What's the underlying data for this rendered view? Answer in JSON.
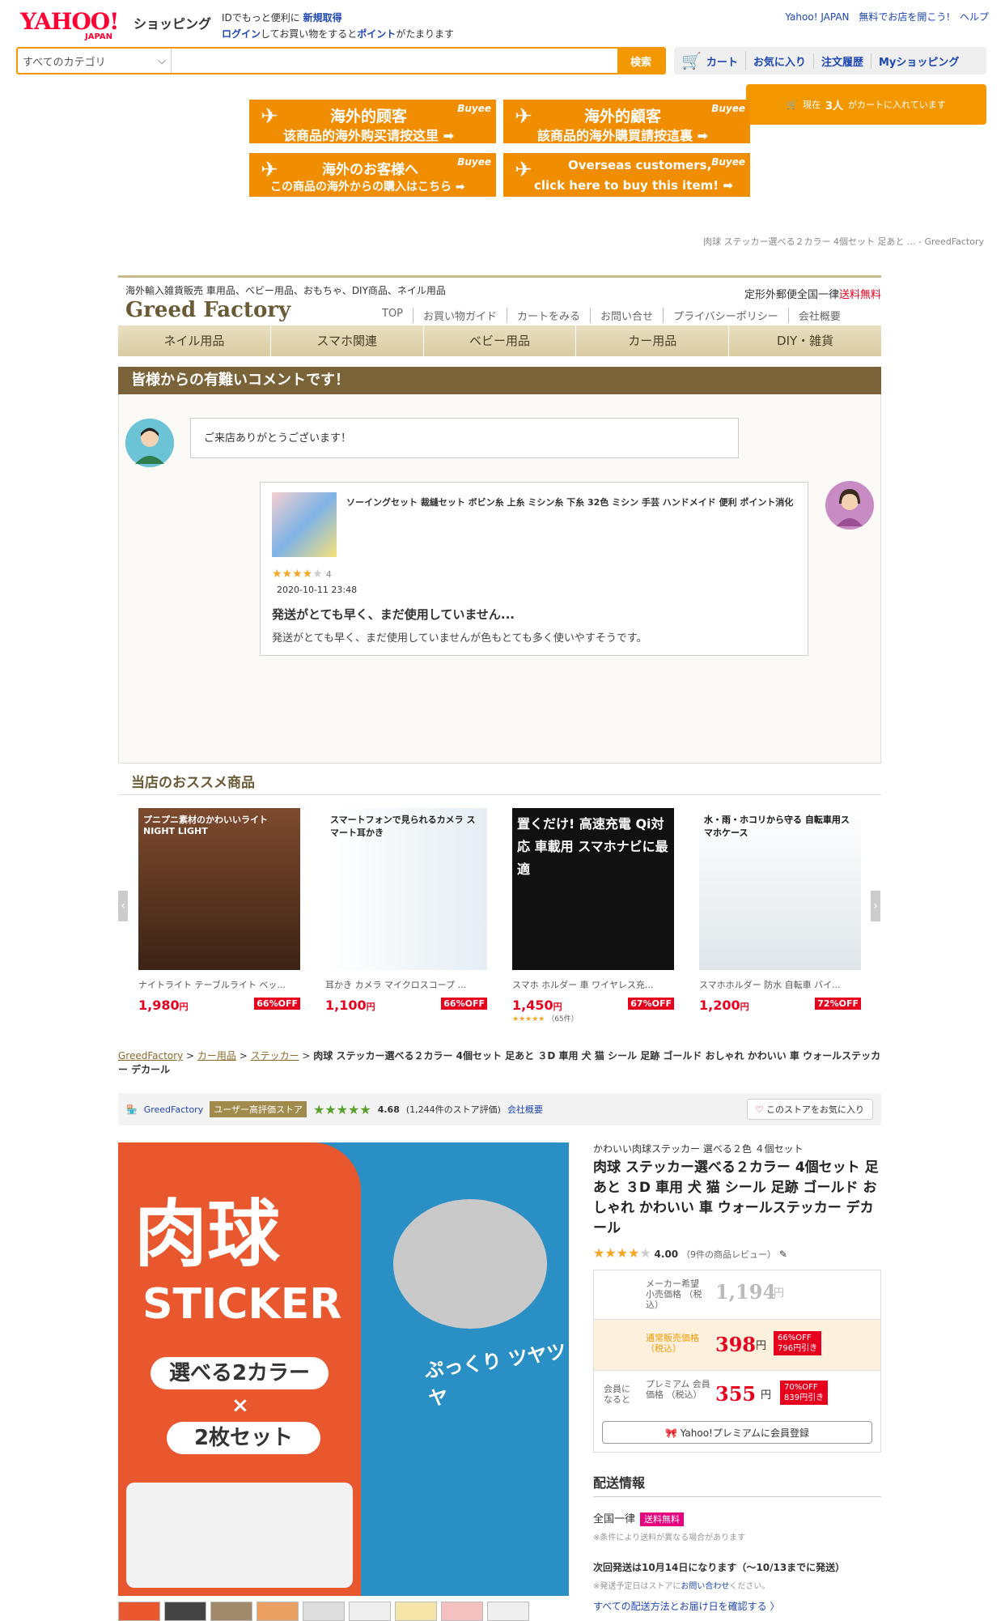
{
  "header": {
    "logo_main": "YAHOO!",
    "logo_sub": "JAPAN",
    "logo_shop": "ショッピング",
    "msg1_a": "IDでもっと便利に",
    "msg1_b": "新規取得",
    "msg2_a": "ログイン",
    "msg2_b": "してお買い物をすると",
    "msg2_c": "ポイント",
    "msg2_d": "がたまります",
    "links": [
      "Yahoo! JAPAN",
      "無料でお店を開こう!",
      "ヘルプ"
    ]
  },
  "search": {
    "category": "すべてのカテゴリ",
    "placeholder": "",
    "button": "検索"
  },
  "topnav": [
    "カート",
    "お気に入り",
    "注文履歴",
    "Myショッピング"
  ],
  "cart_popup": {
    "pre": "現在",
    "count": "3人",
    "post": "がカートに入れています"
  },
  "buyee": [
    {
      "t1": "海外的顾客",
      "t2": "该商品的海外购买请按这里 ➡"
    },
    {
      "t1": "海外的顧客",
      "t2": "該商品的海外購買請按這裏 ➡"
    },
    {
      "t1": "海外のお客様へ",
      "t2": "この商品の海外からの購入はこちら ➡"
    },
    {
      "t1": "Overseas customers,",
      "t2": "click here to buy this item! ➡"
    }
  ],
  "buyee_brand": "Buyee",
  "top_crumb": "肉球 ステッカー選べる２カラー 4個セット 足あと ... - GreedFactory",
  "store": {
    "tagline": "海外輸入雑貨販売 車用品、ベビー用品、おもちゃ、DIY商品、ネイル用品",
    "name": "Greed Factory",
    "ship_a": "定形外郵便全国一律",
    "ship_b": "送料無料",
    "menu": [
      "TOP",
      "お買い物ガイド",
      "カートをみる",
      "お問い合せ",
      "プライバシーポリシー",
      "会社概要"
    ],
    "cats": [
      "ネイル用品",
      "スマホ関連",
      "ベビー用品",
      "カー用品",
      "DIY・雑貨"
    ]
  },
  "comments": {
    "title": "皆様からの有難いコメントです！",
    "greeting": "ご来店ありがとうございます！",
    "review_product": "ソーイングセット 裁縫セット ボビン糸 上糸 ミシン糸 下糸 32色 ミシン 手芸 ハンドメイド 便利 ポイント消化",
    "review_rating": "4",
    "review_date": "2020-10-11 23:48",
    "review_title": "発送がとても早く、まだ使用していません...",
    "review_body": "発送がとても早く、まだ使用していませんが色もとても多く使いやすそうです。"
  },
  "recommend": {
    "title": "当店のおススメ商品",
    "items": [
      {
        "name": "ナイトライト テーブルライト ベッ...",
        "price": "1,980",
        "unit": "円",
        "off": "66%OFF",
        "img_text": "プニプニ素材のかわいいライト NIGHT LIGHT"
      },
      {
        "name": "耳かき カメラ マイクロスコープ ...",
        "price": "1,100",
        "unit": "円",
        "off": "66%OFF",
        "img_text": "スマートフォンで見られるカメラ スマート耳かき"
      },
      {
        "name": "スマホ ホルダー 車 ワイヤレス充...",
        "price": "1,450",
        "unit": "円",
        "off": "67%OFF",
        "img_text": "置くだけ! 高速充電 Qi対応 車載用 スマホナビに最適",
        "reviews": "（65件）"
      },
      {
        "name": "スマホホルダー 防水 自転車 バイ...",
        "price": "1,200",
        "unit": "円",
        "off": "72%OFF",
        "img_text": "水・雨・ホコリから守る 自転車用スマホケース"
      }
    ]
  },
  "breadcrumb": {
    "links": [
      "GreedFactory",
      "カー用品",
      "ステッカー"
    ],
    "current": "肉球 ステッカー選べる２カラー 4個セット 足あと ３D 車用 犬 猫 シール 足跡 ゴールド おしゃれ かわいい 車 ウォールステッカー デカール"
  },
  "storeline": {
    "name": "GreedFactory",
    "badge": "ユーザー高評価ストア",
    "score": "4.68",
    "count": "(1,244件のストア評価)",
    "about": "会社概要",
    "fav": "このストアをお気に入り"
  },
  "product": {
    "catch": "かわいい肉球ステッカー 選べる２色 ４個セット",
    "title": "肉球 ステッカー選べる２カラー 4個セット 足あと ３D 車用 犬 猫 シール 足跡 ゴールド おしゃれ かわいい 車 ウォールステッカー デカール",
    "rating": "4.00",
    "reviews": "（9件の商品レビュー）",
    "img_big": "肉球",
    "img_sticker": "STICKER",
    "img_line1": "選べる2カラー",
    "img_x": "×",
    "img_line2": "2枚セット",
    "img_side": "ぷっくり ツヤツヤ"
  },
  "prices": {
    "list_label": "メーカー希望 小売価格 （税込）",
    "list_price": "1,194",
    "normal_label": "通常販売価格 （税込）",
    "normal_price": "398",
    "normal_off": "66%OFF",
    "normal_diff": "796円引き",
    "member_left": "会員に なると",
    "member_label": "プレミアム 会員価格 （税込）",
    "member_price": "355",
    "member_off": "70%OFF",
    "member_diff": "839円引き",
    "yen": "円",
    "premium_btn": "Yahoo!プレミアムに会員登録"
  },
  "shipping": {
    "title": "配送情報",
    "flat": "全国一律",
    "free": "送料無料",
    "note1": "※条件により送料が異なる場合があります",
    "next": "次回発送は10月14日になります（〜10/13までに発送）",
    "note2_a": "※発送予定日はストアに",
    "note2_b": "お問い合わせ",
    "note2_c": "ください。",
    "link": "すべての配送方法とお届け日を確認する 〉"
  }
}
